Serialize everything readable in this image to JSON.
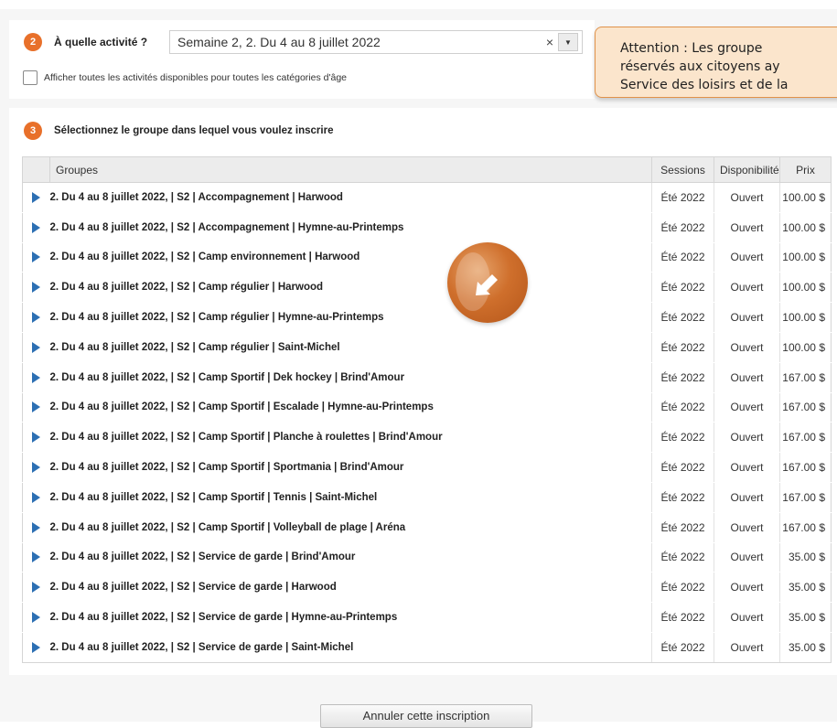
{
  "step_activity": {
    "number": "2",
    "label": "À quelle activité ?",
    "selected": "Semaine 2, 2. Du 4 au 8 juillet 2022",
    "clear_symbol": "×",
    "dropdown_symbol": "▼",
    "checkbox_label": "Afficher toutes les activités disponibles pour toutes les catégories d'âge"
  },
  "warning": {
    "lines": [
      "Attention :  Les  groupe",
      "réservés aux citoyens ay",
      "Service des loisirs et de la"
    ]
  },
  "step_group": {
    "number": "3",
    "label": "Sélectionnez le groupe dans lequel vous voulez inscrire"
  },
  "table": {
    "headers": {
      "groupes": "Groupes",
      "sessions": "Sessions",
      "disponibilite": "Disponibilité",
      "prix": "Prix"
    },
    "rows": [
      {
        "name": "2. Du 4 au 8 juillet 2022, | S2 | Accompagnement | Harwood",
        "session": "Été 2022",
        "status": "Ouvert",
        "price": "100.00 $"
      },
      {
        "name": "2. Du 4 au 8 juillet 2022, | S2 | Accompagnement | Hymne-au-Printemps",
        "session": "Été 2022",
        "status": "Ouvert",
        "price": "100.00 $"
      },
      {
        "name": "2. Du 4 au 8 juillet 2022, | S2 | Camp environnement | Harwood",
        "session": "Été 2022",
        "status": "Ouvert",
        "price": "100.00 $"
      },
      {
        "name": "2. Du 4 au 8 juillet 2022, | S2 | Camp régulier | Harwood",
        "session": "Été 2022",
        "status": "Ouvert",
        "price": "100.00 $"
      },
      {
        "name": "2. Du 4 au 8 juillet 2022, | S2 | Camp régulier | Hymne-au-Printemps",
        "session": "Été 2022",
        "status": "Ouvert",
        "price": "100.00 $"
      },
      {
        "name": "2. Du 4 au 8 juillet 2022, | S2 | Camp régulier | Saint-Michel",
        "session": "Été 2022",
        "status": "Ouvert",
        "price": "100.00 $"
      },
      {
        "name": "2. Du 4 au 8 juillet 2022, | S2 | Camp Sportif | Dek hockey | Brind'Amour",
        "session": "Été 2022",
        "status": "Ouvert",
        "price": "167.00 $"
      },
      {
        "name": "2. Du 4 au 8 juillet 2022, | S2 | Camp Sportif | Escalade | Hymne-au-Printemps",
        "session": "Été 2022",
        "status": "Ouvert",
        "price": "167.00 $"
      },
      {
        "name": "2. Du 4 au 8 juillet 2022, | S2 | Camp Sportif | Planche à roulettes | Brind'Amour",
        "session": "Été 2022",
        "status": "Ouvert",
        "price": "167.00 $"
      },
      {
        "name": "2. Du 4 au 8 juillet 2022, | S2 | Camp Sportif | Sportmania | Brind'Amour",
        "session": "Été 2022",
        "status": "Ouvert",
        "price": "167.00 $"
      },
      {
        "name": "2. Du 4 au 8 juillet 2022, | S2 | Camp Sportif | Tennis | Saint-Michel",
        "session": "Été 2022",
        "status": "Ouvert",
        "price": "167.00 $"
      },
      {
        "name": "2. Du 4 au 8 juillet 2022, | S2 | Camp Sportif | Volleyball de plage | Aréna",
        "session": "Été 2022",
        "status": "Ouvert",
        "price": "167.00 $"
      },
      {
        "name": "2. Du 4 au 8 juillet 2022, | S2 | Service de garde | Brind'Amour",
        "session": "Été 2022",
        "status": "Ouvert",
        "price": "35.00 $"
      },
      {
        "name": "2. Du 4 au 8 juillet 2022, | S2 | Service de garde | Harwood",
        "session": "Été 2022",
        "status": "Ouvert",
        "price": "35.00 $"
      },
      {
        "name": "2. Du 4 au 8 juillet 2022, | S2 | Service de garde | Hymne-au-Printemps",
        "session": "Été 2022",
        "status": "Ouvert",
        "price": "35.00 $"
      },
      {
        "name": "2. Du 4 au 8 juillet 2022, | S2 | Service de garde | Saint-Michel",
        "session": "Été 2022",
        "status": "Ouvert",
        "price": "35.00 $"
      }
    ]
  },
  "cancel_button": {
    "label": "Annuler cette inscription"
  },
  "colors": {
    "accent": "#e8702a",
    "row_arrow": "#2c6fb3",
    "warning_bg": "#fbe5cc",
    "warning_border": "#e0924a"
  },
  "icons": {
    "row_expand": "play-triangle-icon",
    "cursor_highlight": "cursor-pointer-icon"
  }
}
